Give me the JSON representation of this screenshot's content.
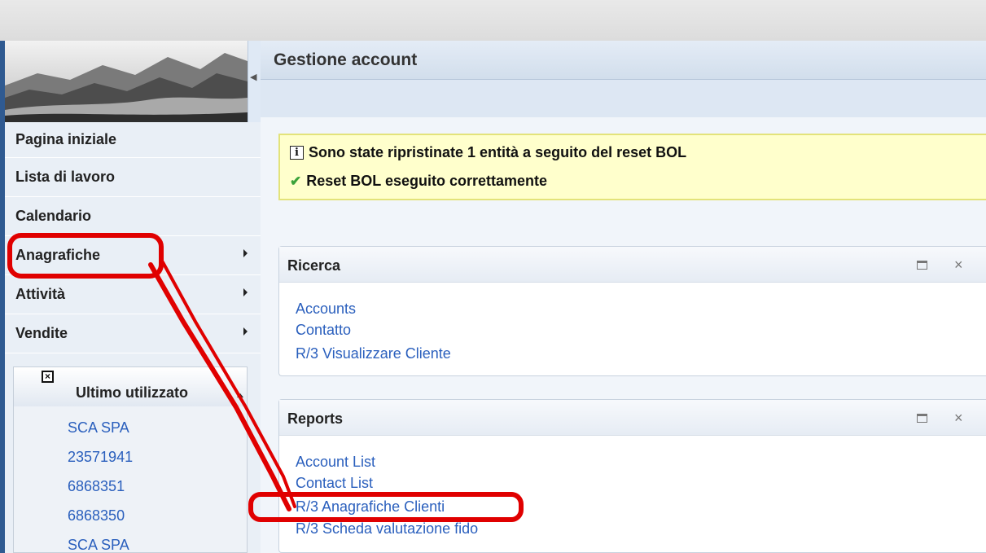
{
  "nav": {
    "items": [
      {
        "label": "Pagina iniziale"
      },
      {
        "label": "Lista di lavoro"
      },
      {
        "label": "Calendario"
      },
      {
        "label": "Anagrafiche"
      },
      {
        "label": "Attività"
      },
      {
        "label": "Vendite"
      }
    ]
  },
  "recent": {
    "title": "Ultimo utilizzato",
    "items": [
      "SCA SPA",
      "23571941",
      "6868351",
      "6868350",
      "SCA SPA"
    ]
  },
  "main": {
    "title": "Gestione account"
  },
  "messages": {
    "info": "Sono state ripristinate 1 entità a seguito del reset BOL",
    "success": "Reset BOL eseguito correttamente"
  },
  "ricerca": {
    "title": "Ricerca",
    "links": [
      "Accounts",
      "Contatto",
      "R/3 Visualizzare Cliente"
    ]
  },
  "reports": {
    "title": "Reports",
    "links": [
      "Account List",
      "Contact List",
      "R/3 Anagrafiche Clienti",
      "R/3 Scheda valutazione fido"
    ]
  },
  "colors": {
    "link": "#2a5fbd",
    "annotation": "#e00000",
    "message_bg": "#ffffcc"
  }
}
